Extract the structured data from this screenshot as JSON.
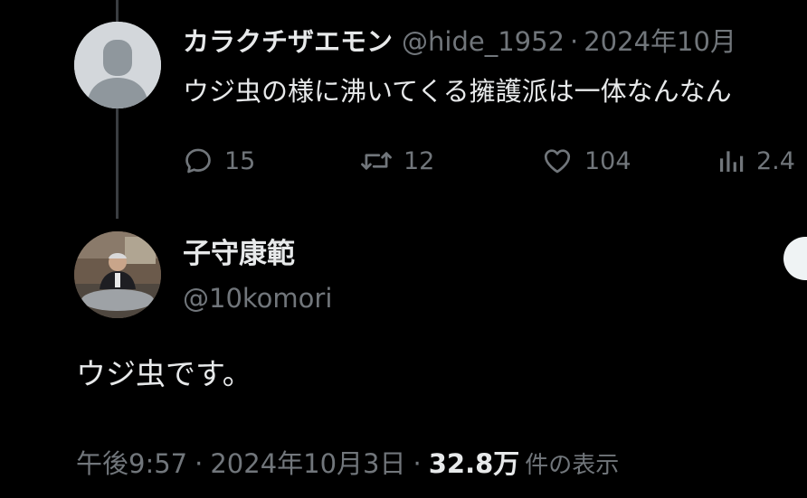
{
  "parent_tweet": {
    "display_name": "カラクチザエモン",
    "handle": "@hide_1952",
    "separator": "·",
    "date": "2024年10月",
    "text": "ウジ虫の様に沸いてくる擁護派は一体なんなん",
    "actions": {
      "replies": "15",
      "retweets": "12",
      "likes": "104",
      "views": "2.4"
    }
  },
  "main_tweet": {
    "display_name": "子守康範",
    "handle": "@10komori",
    "text": "ウジ虫です。",
    "time": "午後9:57",
    "separator": "·",
    "date": "2024年10月3日",
    "separator2": "·",
    "views_count": "32.8万",
    "views_label": "件の表示"
  },
  "colors": {
    "background": "#000000",
    "primary_text": "#e7e9ea",
    "secondary_text": "#71767b",
    "thread_line": "#3a3d41"
  },
  "icons": {
    "reply": "reply-icon",
    "retweet": "retweet-icon",
    "like": "heart-icon",
    "views": "analytics-icon"
  }
}
